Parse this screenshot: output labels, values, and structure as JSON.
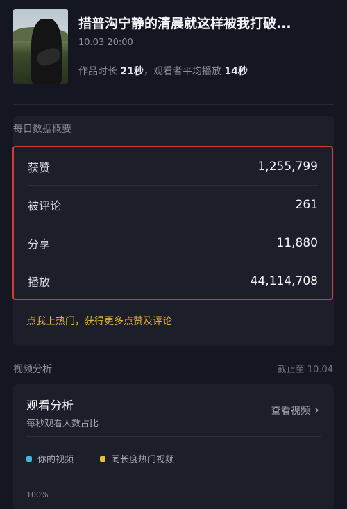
{
  "video": {
    "title": "措普沟宁静的清晨就这样被我打破...",
    "datetime": "10.03 20:00",
    "duration_label": "作品时长",
    "duration_value": "21秒",
    "avg_label": "，观看者平均播放",
    "avg_value": "14秒"
  },
  "daily": {
    "section_title": "每日数据概要",
    "rows": [
      {
        "label": "获赞",
        "value": "1,255,799"
      },
      {
        "label": "被评论",
        "value": "261"
      },
      {
        "label": "分享",
        "value": "11,880"
      },
      {
        "label": "播放",
        "value": "44,114,708"
      }
    ],
    "promo": "点我上热门，获得更多点赞及评论"
  },
  "analysis": {
    "section_title": "视频分析",
    "cutoff": "截止至 10.04",
    "card_title": "观看分析",
    "card_subtitle": "每秒观看人数占比",
    "view_video": "查看视频",
    "legend": [
      {
        "label": "你的视频",
        "color": "#3fb7d8"
      },
      {
        "label": "同长度热门视频",
        "color": "#e6c23a"
      }
    ],
    "y_top_label": "100%"
  },
  "colors": {
    "accent_red": "#d03b3b",
    "promo_yellow": "#e6b23a"
  }
}
